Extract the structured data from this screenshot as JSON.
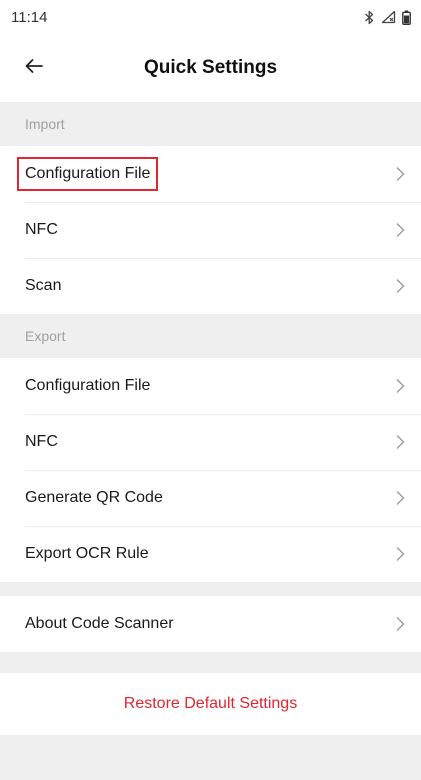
{
  "status_bar": {
    "time": "11:14",
    "icons": [
      "bluetooth-icon",
      "signal-icon",
      "battery-icon"
    ]
  },
  "header": {
    "title": "Quick Settings",
    "back_icon": "arrow-left-icon"
  },
  "import_section": {
    "header": "Import",
    "items": [
      {
        "label": "Configuration File",
        "highlighted": true
      },
      {
        "label": "NFC"
      },
      {
        "label": "Scan"
      }
    ]
  },
  "export_section": {
    "header": "Export",
    "items": [
      {
        "label": "Configuration File"
      },
      {
        "label": "NFC"
      },
      {
        "label": "Generate QR Code"
      },
      {
        "label": "Export OCR Rule"
      }
    ]
  },
  "about": {
    "label": "About Code Scanner"
  },
  "restore": {
    "label": "Restore Default Settings"
  },
  "colors": {
    "accent_red": "#e0262f",
    "background": "#efefef",
    "section_text": "#a0a0a0"
  }
}
